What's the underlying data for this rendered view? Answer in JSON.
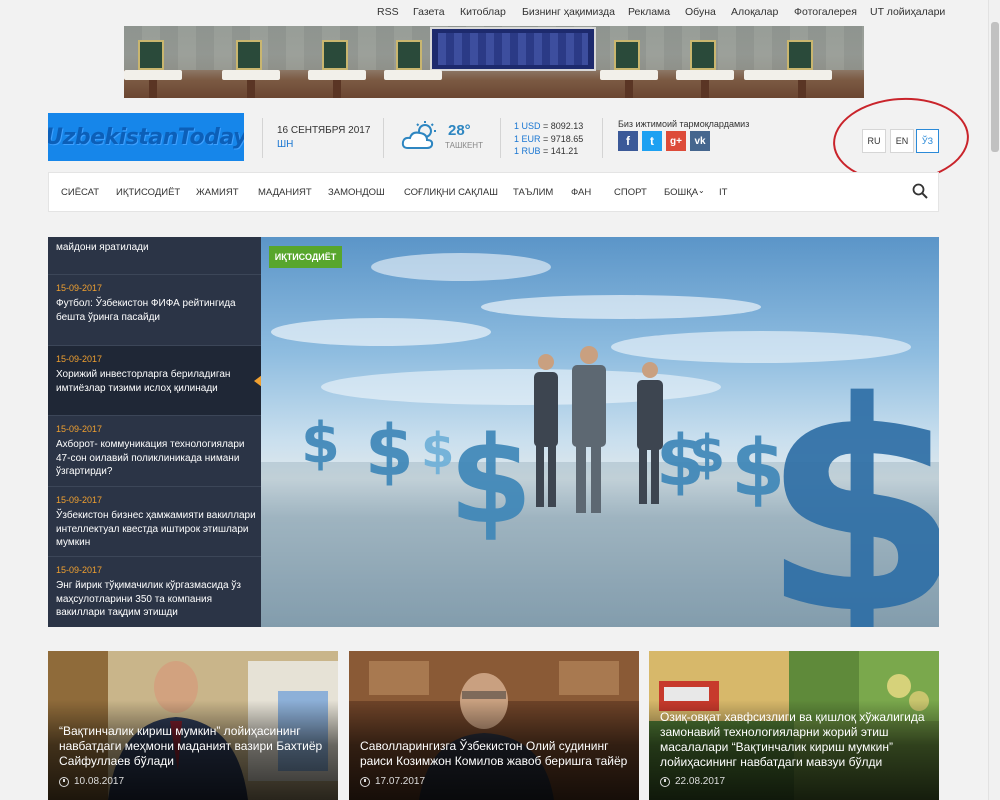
{
  "top_links": [
    "RSS",
    "Газета",
    "Китоблар",
    "Бизнинг ҳақимизда",
    "Реклама",
    "Обуна",
    "Алоқалар",
    "Фотогалерея",
    "UT лойиҳалари"
  ],
  "logo": "UzbekistanToday",
  "date": {
    "full": "16 СЕНТЯБРЯ 2017",
    "day": "ШН"
  },
  "weather": {
    "temp": "28°",
    "city": "ТАШКЕНТ",
    "icon": "partly-cloudy-icon"
  },
  "rates": [
    {
      "currency": "1 USD",
      "value": " = 8092.13"
    },
    {
      "currency": "1 EUR",
      "value": " = 9718.65"
    },
    {
      "currency": "1 RUB",
      "value": " = 141.21"
    }
  ],
  "social": {
    "title": "Биз ижтимоий тармоқлардамиз",
    "buttons": [
      "f",
      "t",
      "g+",
      "vk"
    ]
  },
  "languages": [
    "RU",
    "EN",
    "ЎЗ"
  ],
  "active_language": "ЎЗ",
  "nav": [
    "СИЁСАТ",
    "ИҚТИСОДИЁТ",
    "ЖАМИЯТ",
    "МАДАНИЯТ",
    "ЗАМОНДОШ",
    "СОҒЛИҚНИ САҚЛАШ",
    "ТАЪЛИМ",
    "ФАН",
    "СПОРТ",
    "БОШҚА",
    "IT"
  ],
  "news_list": [
    {
      "date": "",
      "title": "майдони яратилади"
    },
    {
      "date": "15-09-2017",
      "title": "Футбол: Ўзбекистон ФИФА рейтингида бешта ўринга пасайди"
    },
    {
      "date": "15-09-2017",
      "title": "Хорижий инвесторларга бериладиган имтиёзлар тизими ислоҳ қилинади"
    },
    {
      "date": "15-09-2017",
      "title": "Ахборот- коммуникация технологиялари 47-сон оилавий поликлиникада нимани ўзгартирди?"
    },
    {
      "date": "15-09-2017",
      "title": "Ўзбекистон бизнес ҳамжамияти вакиллари интеллектуал квестда иштирок этишлари мумкин"
    },
    {
      "date": "15-09-2017",
      "title": "Энг йирик тўқимачилик кўргазмасида ўз маҳсулотларини 350 та компания вакиллари тақдим этишди"
    }
  ],
  "hero_tag": "ИҚТИСОДИЁТ",
  "cards": [
    {
      "title": "“Вақтинчалик кириш мумкин” лойиҳасининг навбатдаги меҳмони маданият вазири Бахтиёр Сайфуллаев бўлади",
      "date": "10.08.2017"
    },
    {
      "title": "Саволларингизга Ўзбекистон Олий судининг раиси Козимжон Комилов жавоб беришга тайёр",
      "date": "17.07.2017"
    },
    {
      "title": "Озиқ-овқат хавфсизлиги ва қишлоқ хўжалигида замонавий технологияларни жорий этиш масалалари “Вақтинчалик кириш мумкин” лойиҳасининг навбатдаги мавзуи бўлди",
      "date": "22.08.2017"
    }
  ]
}
